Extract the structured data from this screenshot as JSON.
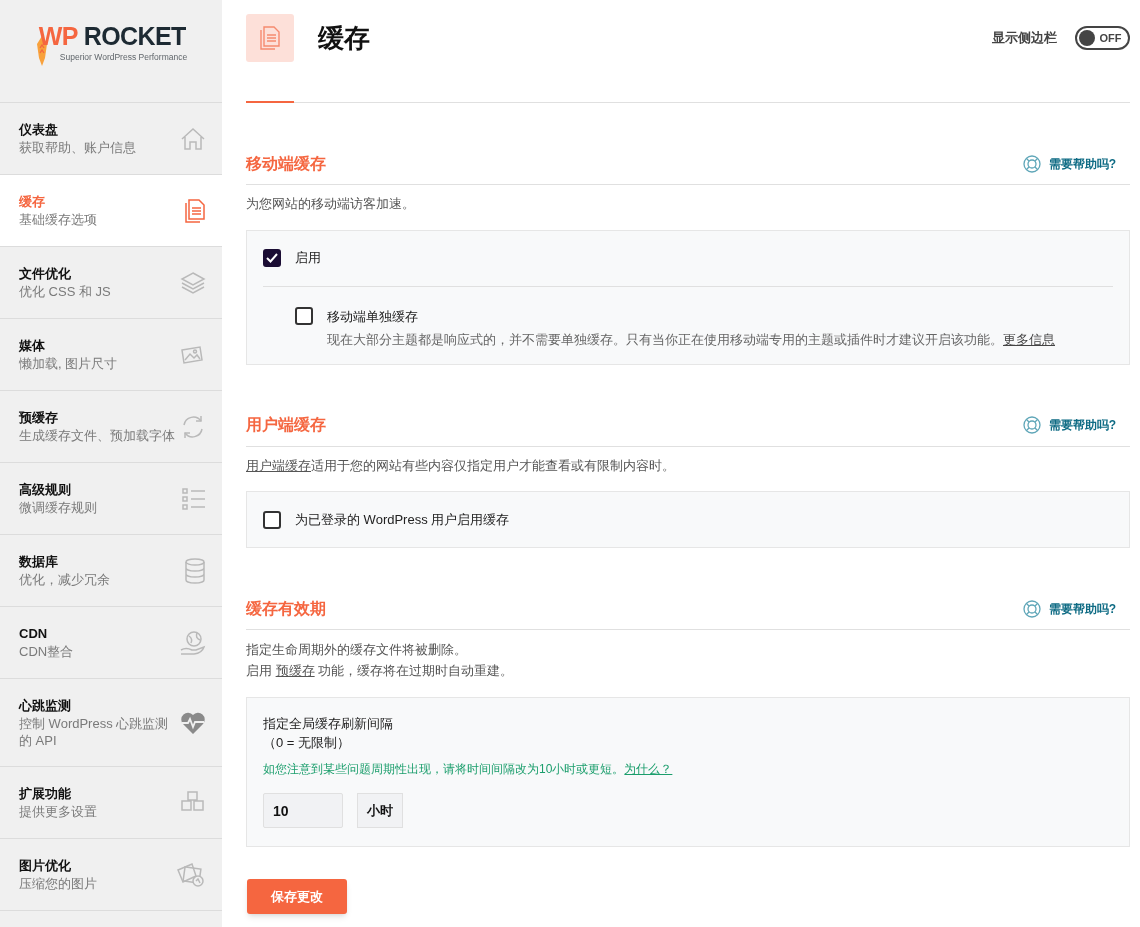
{
  "logo": {
    "brand_a": "WP",
    "brand_b": "ROCKET",
    "tagline": "Superior WordPress Performance"
  },
  "sidebar": {
    "items": [
      {
        "title": "仪表盘",
        "subtitle": "获取帮助、账户信息",
        "selected": false
      },
      {
        "title": "缓存",
        "subtitle": "基础缓存选项",
        "selected": true
      },
      {
        "title": "文件优化",
        "subtitle": "优化 CSS 和 JS",
        "selected": false
      },
      {
        "title": "媒体",
        "subtitle": "懒加载, 图片尺寸",
        "selected": false
      },
      {
        "title": "预缓存",
        "subtitle": "生成缓存文件、预加载字体",
        "selected": false
      },
      {
        "title": "高级规则",
        "subtitle": "微调缓存规则",
        "selected": false
      },
      {
        "title": "数据库",
        "subtitle": "优化，减少冗余",
        "selected": false
      },
      {
        "title": "CDN",
        "subtitle": "CDN整合",
        "selected": false
      },
      {
        "title": "心跳监测",
        "subtitle": "控制 WordPress 心跳监测的 API",
        "selected": false
      },
      {
        "title": "扩展功能",
        "subtitle": "提供更多设置",
        "selected": false
      },
      {
        "title": "图片优化",
        "subtitle": "压缩您的图片",
        "selected": false
      }
    ]
  },
  "header": {
    "title": "缓存",
    "sidebar_toggle": {
      "label": "显示侧边栏",
      "on": false,
      "state_text": "OFF"
    }
  },
  "mobile_cache": {
    "title": "移动端缓存",
    "help": "需要帮助吗?",
    "description": "为您网站的移动端访客加速。",
    "options": [
      {
        "label": "启用",
        "checked": true
      },
      {
        "label": "移动端单独缓存",
        "checked": false,
        "description": "现在大部分主题都是响应式的，并不需要单独缓存。只有当你正在使用移动端专用的主题或插件时才建议开启该功能。",
        "link": "更多信息"
      }
    ]
  },
  "user_cache": {
    "title": "用户端缓存",
    "help": "需要帮助吗?",
    "description_link": "用户端缓存",
    "description": "适用于您的网站有些内容仅指定用户才能查看或有限制内容时。",
    "option": {
      "label": "为已登录的 WordPress 用户启用缓存",
      "checked": false
    }
  },
  "cache_lifespan": {
    "title": "缓存有效期",
    "help": "需要帮助吗?",
    "description": "指定生命周期外的缓存文件将被删除。",
    "description2_before": "启用 ",
    "description2_link": "预缓存",
    "description2_after": " 功能，缓存将在过期时自动重建。",
    "field_label": "指定全局缓存刷新间隔",
    "field_hint": "（0 = 无限制）",
    "warning": "如您注意到某些问题周期性出现，请将时间间隔改为10小时或更短。",
    "warning_link": "为什么？",
    "value": "10",
    "unit": "小时"
  },
  "save_button": "保存更改"
}
